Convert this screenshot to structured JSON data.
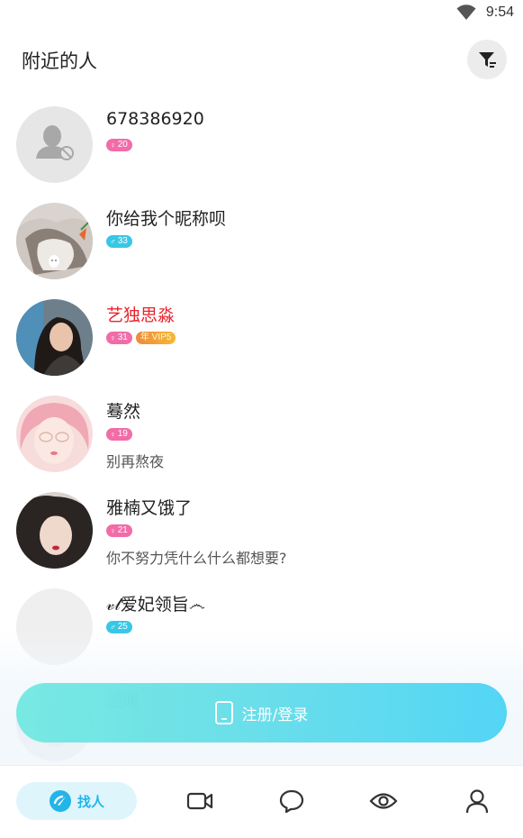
{
  "status_bar": {
    "time": "9:54"
  },
  "header": {
    "title": "附近的人"
  },
  "users": [
    {
      "name": "678386920",
      "gender": "female",
      "gender_symbol": "♀",
      "age": "20",
      "vip_badge": "",
      "signature": "",
      "name_color": "#222222"
    },
    {
      "name": "你给我个昵称呗",
      "gender": "male",
      "gender_symbol": "♂",
      "age": "33",
      "vip_badge": "",
      "signature": "",
      "name_color": "#222222"
    },
    {
      "name": "艺独思淼",
      "gender": "female",
      "gender_symbol": "♀",
      "age": "31",
      "vip_badge": "年 VIP5",
      "signature": "",
      "name_color": "#e8242c"
    },
    {
      "name": "蓦然",
      "gender": "female",
      "gender_symbol": "♀",
      "age": "19",
      "vip_badge": "",
      "signature": "别再熬夜",
      "name_color": "#222222"
    },
    {
      "name": "雅楠又饿了",
      "gender": "female",
      "gender_symbol": "♀",
      "age": "21",
      "vip_badge": "",
      "signature": "你不努力凭什么什么都想要?",
      "name_color": "#222222"
    },
    {
      "name": "𝓋𝓁爱妃领旨෴",
      "gender": "male",
      "gender_symbol": "♂",
      "age": "25",
      "vip_badge": "",
      "signature": "",
      "name_color": "#222222"
    },
    {
      "name": "温暖",
      "gender": "female",
      "gender_symbol": "♀",
      "age": "",
      "vip_badge": "",
      "signature": "",
      "name_color": "#222222"
    }
  ],
  "register": {
    "label": "注册/登录"
  },
  "bottom_nav": {
    "find_label": "找人",
    "icons": [
      "find-people-icon",
      "video-icon",
      "chat-bubble-icon",
      "eye-icon",
      "profile-icon"
    ]
  },
  "colors": {
    "accent": "#23b4e8",
    "female_tag": "#f26ca8",
    "male_tag": "#38c7e6",
    "vip_name": "#e8242c"
  }
}
